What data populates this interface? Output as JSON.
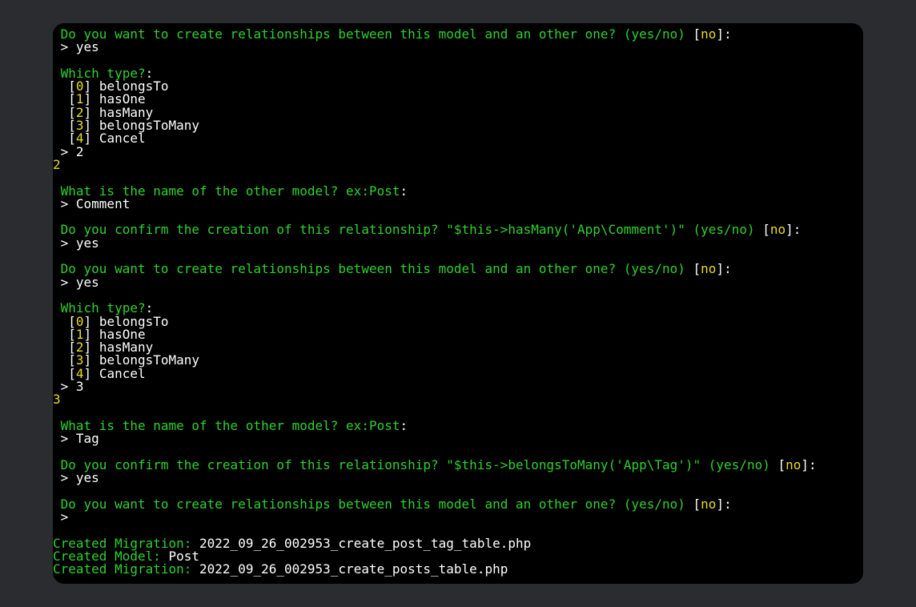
{
  "lines": [
    [
      [
        "g",
        " Do you want to create relationships between this model and an other one? (yes/no) "
      ],
      [
        "w",
        "["
      ],
      [
        "y",
        "no"
      ],
      [
        "w",
        "]:"
      ]
    ],
    [
      [
        "w",
        " > yes"
      ]
    ],
    [],
    [
      [
        "g",
        " Which type?"
      ],
      [
        "w",
        ":"
      ]
    ],
    [
      [
        "w",
        "  ["
      ],
      [
        "y",
        "0"
      ],
      [
        "w",
        "] belongsTo"
      ]
    ],
    [
      [
        "w",
        "  ["
      ],
      [
        "y",
        "1"
      ],
      [
        "w",
        "] hasOne"
      ]
    ],
    [
      [
        "w",
        "  ["
      ],
      [
        "y",
        "2"
      ],
      [
        "w",
        "] hasMany"
      ]
    ],
    [
      [
        "w",
        "  ["
      ],
      [
        "y",
        "3"
      ],
      [
        "w",
        "] belongsToMany"
      ]
    ],
    [
      [
        "w",
        "  ["
      ],
      [
        "y",
        "4"
      ],
      [
        "w",
        "] Cancel"
      ]
    ],
    [
      [
        "w",
        " > 2"
      ]
    ],
    [
      [
        "y",
        "2"
      ]
    ],
    [],
    [
      [
        "g",
        " What is the name of the other model? ex:Post"
      ],
      [
        "w",
        ":"
      ]
    ],
    [
      [
        "w",
        " > Comment"
      ]
    ],
    [],
    [
      [
        "g",
        " Do you confirm the creation of this relationship? \"$this->hasMany('App\\Comment')\" (yes/no) "
      ],
      [
        "w",
        "["
      ],
      [
        "y",
        "no"
      ],
      [
        "w",
        "]:"
      ]
    ],
    [
      [
        "w",
        " > yes"
      ]
    ],
    [],
    [
      [
        "g",
        " Do you want to create relationships between this model and an other one? (yes/no) "
      ],
      [
        "w",
        "["
      ],
      [
        "y",
        "no"
      ],
      [
        "w",
        "]:"
      ]
    ],
    [
      [
        "w",
        " > yes"
      ]
    ],
    [],
    [
      [
        "g",
        " Which type?"
      ],
      [
        "w",
        ":"
      ]
    ],
    [
      [
        "w",
        "  ["
      ],
      [
        "y",
        "0"
      ],
      [
        "w",
        "] belongsTo"
      ]
    ],
    [
      [
        "w",
        "  ["
      ],
      [
        "y",
        "1"
      ],
      [
        "w",
        "] hasOne"
      ]
    ],
    [
      [
        "w",
        "  ["
      ],
      [
        "y",
        "2"
      ],
      [
        "w",
        "] hasMany"
      ]
    ],
    [
      [
        "w",
        "  ["
      ],
      [
        "y",
        "3"
      ],
      [
        "w",
        "] belongsToMany"
      ]
    ],
    [
      [
        "w",
        "  ["
      ],
      [
        "y",
        "4"
      ],
      [
        "w",
        "] Cancel"
      ]
    ],
    [
      [
        "w",
        " > 3"
      ]
    ],
    [
      [
        "y",
        "3"
      ]
    ],
    [],
    [
      [
        "g",
        " What is the name of the other model? ex:Post"
      ],
      [
        "w",
        ":"
      ]
    ],
    [
      [
        "w",
        " > Tag"
      ]
    ],
    [],
    [
      [
        "g",
        " Do you confirm the creation of this relationship? \"$this->belongsToMany('App\\Tag')\" (yes/no) "
      ],
      [
        "w",
        "["
      ],
      [
        "y",
        "no"
      ],
      [
        "w",
        "]:"
      ]
    ],
    [
      [
        "w",
        " > yes"
      ]
    ],
    [],
    [
      [
        "g",
        " Do you want to create relationships between this model and an other one? (yes/no) "
      ],
      [
        "w",
        "["
      ],
      [
        "y",
        "no"
      ],
      [
        "w",
        "]:"
      ]
    ],
    [
      [
        "w",
        " >"
      ]
    ],
    [],
    [
      [
        "g",
        "Created Migration: "
      ],
      [
        "w",
        "2022_09_26_002953_create_post_tag_table.php"
      ]
    ],
    [
      [
        "g",
        "Created Model: "
      ],
      [
        "w",
        "Post"
      ]
    ],
    [
      [
        "g",
        "Created Migration: "
      ],
      [
        "w",
        "2022_09_26_002953_create_posts_table.php"
      ]
    ]
  ]
}
